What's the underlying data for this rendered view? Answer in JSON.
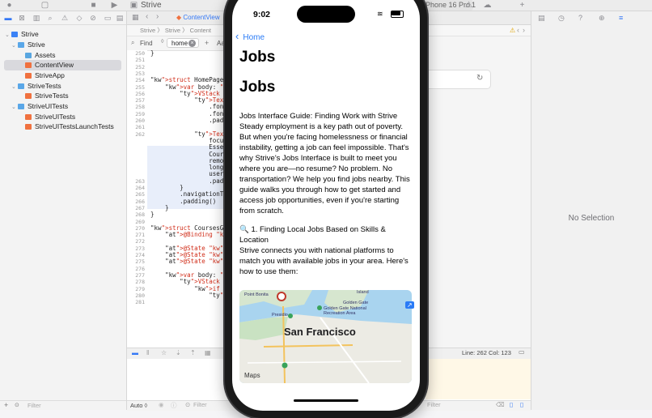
{
  "toolbar": {
    "app_title": "Strive",
    "run_destination": "iPhone 16 Pro",
    "warning_count": "1"
  },
  "editor_tab": {
    "label": "ContentView"
  },
  "jumpbar": {
    "path": "Strive 〉 Strive 〉 Content"
  },
  "find": {
    "mode_label": "Find",
    "query": "home",
    "options_label": "Aa"
  },
  "navigator": {
    "items": [
      {
        "label": "Strive",
        "kind": "project"
      },
      {
        "label": "Strive",
        "kind": "folder"
      },
      {
        "label": "Assets",
        "kind": "assets"
      },
      {
        "label": "ContentView",
        "kind": "swift"
      },
      {
        "label": "StriveApp",
        "kind": "swift"
      },
      {
        "label": "StriveTests",
        "kind": "folder"
      },
      {
        "label": "StriveTests",
        "kind": "swift"
      },
      {
        "label": "StriveUITests",
        "kind": "folder"
      },
      {
        "label": "StriveUITests",
        "kind": "swift"
      },
      {
        "label": "StriveUITestsLaunchTests",
        "kind": "swift"
      }
    ],
    "filter_placeholder": "Filter"
  },
  "code": {
    "lines": [
      {
        "n": "250",
        "text": "}"
      },
      {
        "n": "251",
        "text": ""
      },
      {
        "n": "252",
        "text": ""
      },
      {
        "n": "253",
        "text": ""
      },
      {
        "n": "254",
        "text": "struct HomePage: View"
      },
      {
        "n": "255",
        "text": "    var body: some Vi"
      },
      {
        "n": "256",
        "text": "        VStack {"
      },
      {
        "n": "257",
        "text": "            Text(\"Wel"
      },
      {
        "n": "258",
        "text": "                .font"
      },
      {
        "n": "259",
        "text": "                .font"
      },
      {
        "n": "260",
        "text": "                .padd"
      },
      {
        "n": "261",
        "text": ""
      },
      {
        "n": "262",
        "text": "            Text(\"Wel"
      },
      {
        "n": "",
        "text": "                focus"
      },
      {
        "n": "",
        "text": "                Essen"
      },
      {
        "n": "",
        "text": "                Cours"
      },
      {
        "n": "",
        "text": "                remov"
      },
      {
        "n": "",
        "text": "                long-"
      },
      {
        "n": "",
        "text": "                users"
      },
      {
        "n": "263",
        "text": "                .padd"
      },
      {
        "n": "264",
        "text": "        }"
      },
      {
        "n": "265",
        "text": "        .navigationTi"
      },
      {
        "n": "266",
        "text": "        .padding()"
      },
      {
        "n": "267",
        "text": "    }"
      },
      {
        "n": "268",
        "text": "}"
      },
      {
        "n": "269",
        "text": ""
      },
      {
        "n": "270",
        "text": "struct CoursesGatekeep"
      },
      {
        "n": "271",
        "text": "    @Binding var isSub"
      },
      {
        "n": "272",
        "text": ""
      },
      {
        "n": "273",
        "text": "    @State private va"
      },
      {
        "n": "274",
        "text": "    @State private va"
      },
      {
        "n": "275",
        "text": "    @State private va"
      },
      {
        "n": "276",
        "text": ""
      },
      {
        "n": "277",
        "text": "    var body: some Vi"
      },
      {
        "n": "278",
        "text": "        VStack {"
      },
      {
        "n": "279",
        "text": "            if !isSubs"
      },
      {
        "n": "280",
        "text": "                Form"
      },
      {
        "n": "281",
        "text": "                    S"
      }
    ]
  },
  "status": {
    "line_col": "Line: 262  Col: 123",
    "auto_label": "Auto ◊",
    "filter_placeholder": "Filter"
  },
  "inspector": {
    "empty_label": "No Selection"
  },
  "phone": {
    "time": "9:02",
    "back_label": "Home",
    "nav_title": "Jobs",
    "content_title": "Jobs",
    "body": "Jobs Interface Guide: Finding Work with Strive Steady employment is a key path out of poverty. But when you're facing homelessness or financial instability, getting a job can feel impossible. That's why Strive's Jobs Interface is built to meet you where you are—no resume? No problem. No transportation? We help you find jobs nearby. This guide walks you through how to get started and access job opportunities, even if you're starting from scratch.",
    "section_heading": "🔍 1. Finding Local Jobs Based on Skills & Location",
    "section_body": "Strive connects you with national platforms to match you with available jobs in your area. Here's how to use them:",
    "map": {
      "city": "San Francisco",
      "logo": "Maps",
      "labels": [
        "Point Bonita",
        "Golden Gate",
        "Golden Gate National Recreation Area",
        "Presidio",
        "Island"
      ]
    }
  }
}
